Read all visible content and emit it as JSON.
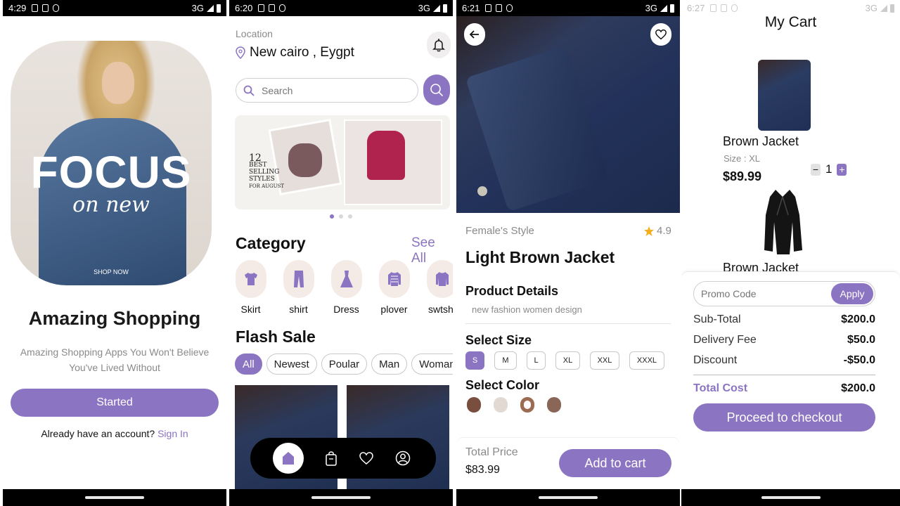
{
  "screens": {
    "onboarding": {
      "status_time": "4:29",
      "network": "3G",
      "hero_headline": "FOCUS",
      "hero_subheadline": "on new",
      "hero_cta": "SHOP NOW",
      "title": "Amazing Shopping",
      "subtitle": "Amazing Shopping Apps You Won't Believe You've Lived Without",
      "started_button": "Started",
      "account_prompt": "Already have an account?",
      "sign_in_link": "Sign In"
    },
    "home": {
      "status_time": "6:20",
      "network": "3G",
      "location_label": "Location",
      "location_value": "New cairo , Eygpt",
      "search_placeholder": "Search",
      "banner": {
        "number": "12",
        "line1": "BEST",
        "line2": "SELLING",
        "line3": "STYLES",
        "line4": "FOR AUGUST"
      },
      "carousel_active_index": 0,
      "category_title": "Category",
      "see_all": "See All",
      "categories": [
        {
          "label": "Skirt",
          "icon": "tshirt-icon"
        },
        {
          "label": "shirt",
          "icon": "pants-icon"
        },
        {
          "label": "Dress",
          "icon": "dress-icon"
        },
        {
          "label": "plover",
          "icon": "sweater-icon"
        },
        {
          "label": "swtshi",
          "icon": "sweatshirt-icon"
        }
      ],
      "flash_sale_title": "Flash Sale",
      "filter_chips": [
        {
          "label": "All",
          "active": true
        },
        {
          "label": "Newest",
          "active": false
        },
        {
          "label": "Poular",
          "active": false
        },
        {
          "label": "Man",
          "active": false
        },
        {
          "label": "Woman",
          "active": false
        }
      ],
      "bottom_nav": [
        "home-icon",
        "bag-icon",
        "heart-icon",
        "profile-icon"
      ]
    },
    "product": {
      "status_time": "6:21",
      "network": "3G",
      "category": "Female's Style",
      "rating": "4.9",
      "name": "Light Brown Jacket",
      "details_heading": "Product Details",
      "details_text": "new fashion women design",
      "size_heading": "Select Size",
      "sizes": [
        {
          "label": "S",
          "active": true
        },
        {
          "label": "M",
          "active": false
        },
        {
          "label": "L",
          "active": false
        },
        {
          "label": "XL",
          "active": false
        },
        {
          "label": "XXL",
          "active": false
        },
        {
          "label": "XXXL",
          "active": false
        }
      ],
      "color_heading": "Select Color",
      "colors": [
        {
          "hex": "#7a4e3e",
          "selected": false
        },
        {
          "hex": "#e2d9d2",
          "selected": false
        },
        {
          "hex": "#9b6b52",
          "selected": true
        },
        {
          "hex": "#8a6656",
          "selected": false
        }
      ],
      "total_label": "Total Price",
      "total_value": "$83.99",
      "add_to_cart": "Add to cart"
    },
    "cart": {
      "status_time": "6:27",
      "network": "3G",
      "title": "My Cart",
      "items": [
        {
          "name": "Brown Jacket",
          "size": "Size : XL",
          "price": "$89.99",
          "qty": "1"
        },
        {
          "name": "Brown Jacket"
        }
      ],
      "promo_placeholder": "Promo Code",
      "apply_button": "Apply",
      "subtotal_label": "Sub-Total",
      "subtotal_value": "$200.0",
      "delivery_label": "Delivery Fee",
      "delivery_value": "$50.0",
      "discount_label": "Discount",
      "discount_value": "-$50.0",
      "total_label": "Total Cost",
      "total_value": "$200.0",
      "checkout_button": "Proceed to checkout"
    }
  },
  "colors": {
    "accent": "#8b74c2",
    "category_bg": "#f5ebe6",
    "muted_text": "#8a8a8a"
  }
}
